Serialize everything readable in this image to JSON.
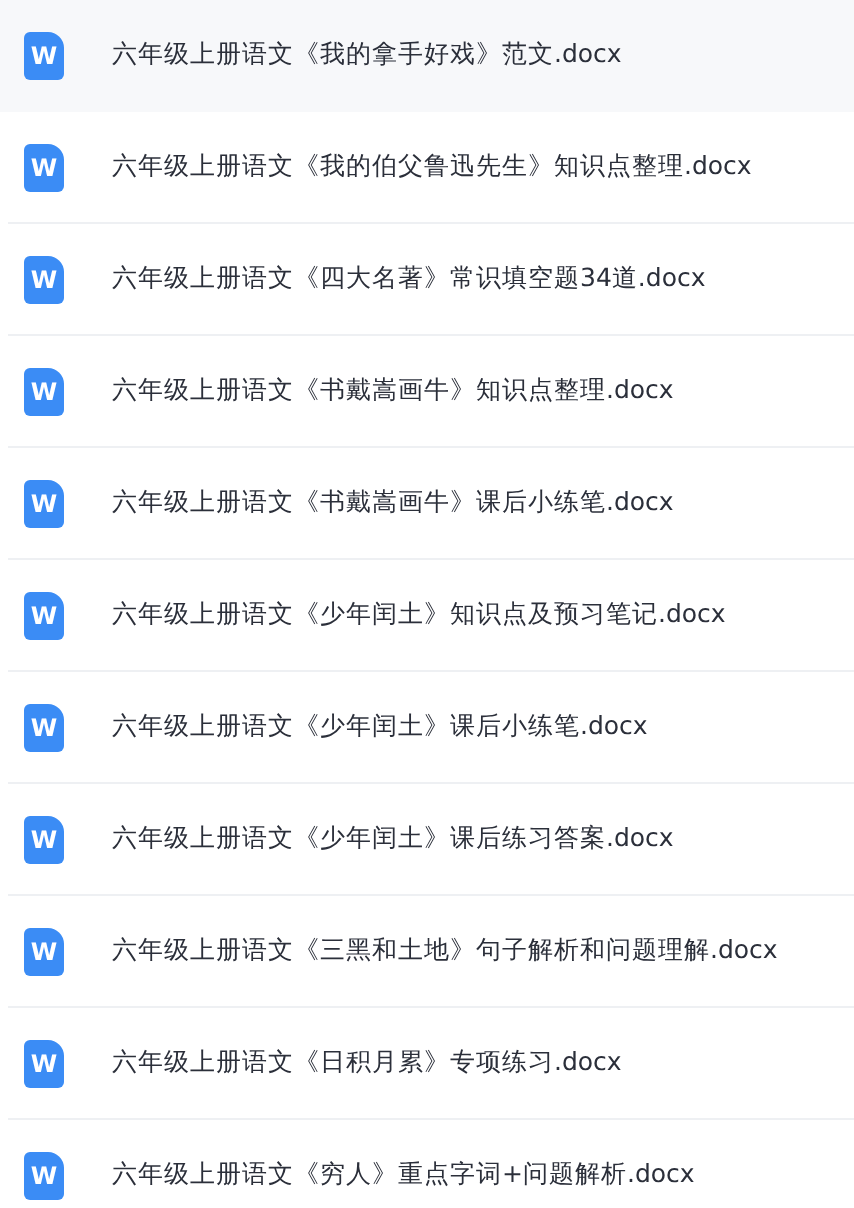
{
  "files": [
    {
      "name": "六年级上册语文《我的拿手好戏》范文.docx",
      "icon_text": "W",
      "selected": true
    },
    {
      "name": "六年级上册语文《我的伯父鲁迅先生》知识点整理.docx",
      "icon_text": "W",
      "selected": false
    },
    {
      "name": "六年级上册语文《四大名著》常识填空题34道.docx",
      "icon_text": "W",
      "selected": false
    },
    {
      "name": "六年级上册语文《书戴嵩画牛》知识点整理.docx",
      "icon_text": "W",
      "selected": false
    },
    {
      "name": "六年级上册语文《书戴嵩画牛》课后小练笔.docx",
      "icon_text": "W",
      "selected": false
    },
    {
      "name": "六年级上册语文《少年闰土》知识点及预习笔记.docx",
      "icon_text": "W",
      "selected": false
    },
    {
      "name": "六年级上册语文《少年闰土》课后小练笔.docx",
      "icon_text": "W",
      "selected": false
    },
    {
      "name": "六年级上册语文《少年闰土》课后练习答案.docx",
      "icon_text": "W",
      "selected": false
    },
    {
      "name": "六年级上册语文《三黑和土地》句子解析和问题理解.docx",
      "icon_text": "W",
      "selected": false
    },
    {
      "name": "六年级上册语文《日积月累》专项练习.docx",
      "icon_text": "W",
      "selected": false
    },
    {
      "name": "六年级上册语文《穷人》重点字词+问题解析.docx",
      "icon_text": "W",
      "selected": false
    }
  ]
}
